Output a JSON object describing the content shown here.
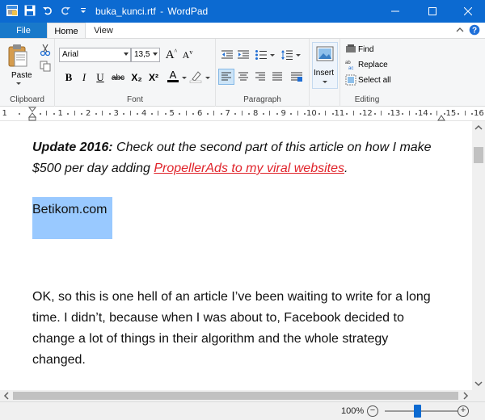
{
  "window": {
    "filename": "buka_kunci.rtf",
    "separator": "-",
    "app_name": "WordPad"
  },
  "tabs": {
    "file": "File",
    "home": "Home",
    "view": "View"
  },
  "clipboard": {
    "paste": "Paste",
    "group_label": "Clipboard"
  },
  "font": {
    "family": "Arial",
    "size": "13,5",
    "bold": "B",
    "italic": "I",
    "underline": "U",
    "strikethrough": "abc",
    "subscript": "X₂",
    "superscript": "X²",
    "color_letter": "A",
    "group_label": "Font"
  },
  "paragraph": {
    "group_label": "Paragraph"
  },
  "insert": {
    "label": "Insert"
  },
  "editing": {
    "find": "Find",
    "replace": "Replace",
    "select_all": "Select all",
    "group_label": "Editing"
  },
  "ruler": {
    "numbers": [
      "1",
      "2",
      "3",
      "4",
      "5",
      "6",
      "7",
      "8",
      "9",
      "10",
      "11",
      "12",
      "13",
      "14",
      "15",
      "16"
    ]
  },
  "document": {
    "update_bold": "Update 2016:",
    "update_text": " Check out the second part of this article on how I make $500 per day adding ",
    "update_link": "PropellerAds to my viral websites",
    "update_end": ".",
    "selected_text": "Betikom.com",
    "body": "OK, so this is one hell of an article I’ve been waiting to write for a long time. I didn’t, because when I was about to, Facebook decided to change a lot of things in their algorithm and the whole strategy changed."
  },
  "status": {
    "zoom": "100%",
    "zoom_level": 0.5
  },
  "colors": {
    "title_bar": "#0c6ad1",
    "file_tab": "#1979ca",
    "link": "#e0242b",
    "selection": "#99c9ff"
  }
}
